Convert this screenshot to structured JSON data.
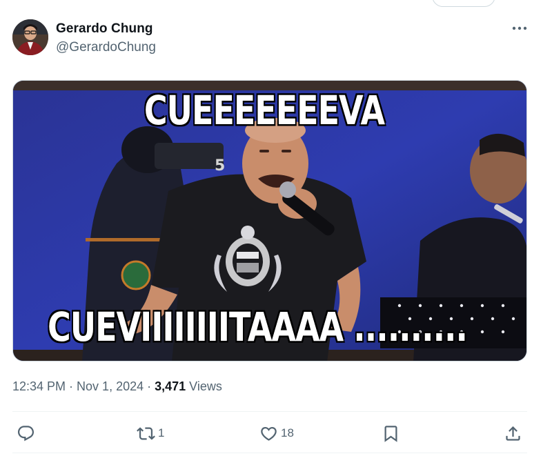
{
  "tweet": {
    "author_name": "Gerardo Chung",
    "author_handle": "@GerardoChung",
    "more_icon": "more-horizontal-icon",
    "media": {
      "caption_top": "CUEEEEEEEVA",
      "caption_bottom": "CUEVIIIIIIIITAAAA ..........",
      "colors": {
        "stage_blue": "#2a36a8",
        "shirt": "#1b1b1f",
        "skin": "#c98d6b"
      }
    },
    "meta": {
      "time": "12:34 PM",
      "separator": " · ",
      "date": "Nov 1, 2024",
      "views_count": "3,471",
      "views_label": " Views"
    },
    "actions": {
      "reply": {
        "icon": "reply-icon",
        "count": ""
      },
      "retweet": {
        "icon": "retweet-icon",
        "count": "1"
      },
      "like": {
        "icon": "heart-icon",
        "count": "18"
      },
      "bookmark": {
        "icon": "bookmark-icon",
        "count": ""
      },
      "share": {
        "icon": "share-icon",
        "count": ""
      }
    }
  },
  "colors": {
    "text_primary": "#0f1419",
    "text_secondary": "#536471",
    "border": "#cfd9de",
    "divider": "#eff3f4"
  }
}
